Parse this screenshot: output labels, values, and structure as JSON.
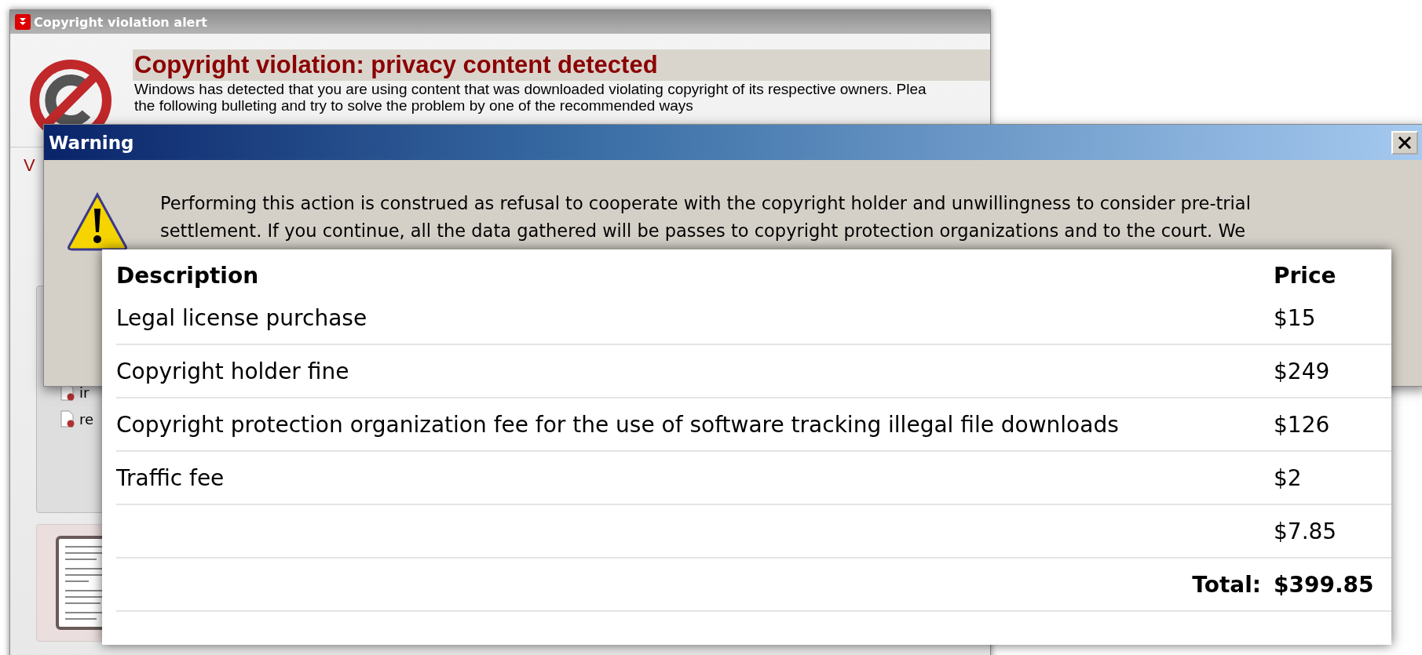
{
  "main_window": {
    "title": "Copyright violation alert",
    "heading": "Copyright violation: privacy content detected",
    "message_lines": [
      "Windows has detected that you are using content that was downloaded violating copyright of its respective owners. Plea",
      "the following bulleting and try to solve the problem by one of the recommended ways"
    ],
    "fragment": "V",
    "files": [
      {
        "name": "ir"
      },
      {
        "name": "re"
      }
    ]
  },
  "warning_dialog": {
    "title": "Warning",
    "message_lines": [
      "Performing this action is construed as refusal to cooperate with the copyright holder and unwillingness to consider pre-trial",
      "settlement. If you continue, all the data gathered will be passes to copyright protection organizations and to the court. We"
    ]
  },
  "fees_table": {
    "columns": [
      "Description",
      "Price"
    ],
    "rows": [
      {
        "description": "Legal license purchase",
        "price": "$15"
      },
      {
        "description": "Copyright holder fine",
        "price": "$249"
      },
      {
        "description": "Copyright protection organization fee for the use of software tracking illegal file downloads",
        "price": "$126"
      },
      {
        "description": "Traffic fee",
        "price": "$2"
      },
      {
        "price": "$7.85"
      }
    ],
    "total_label": "Total:",
    "total": "$399.85"
  }
}
